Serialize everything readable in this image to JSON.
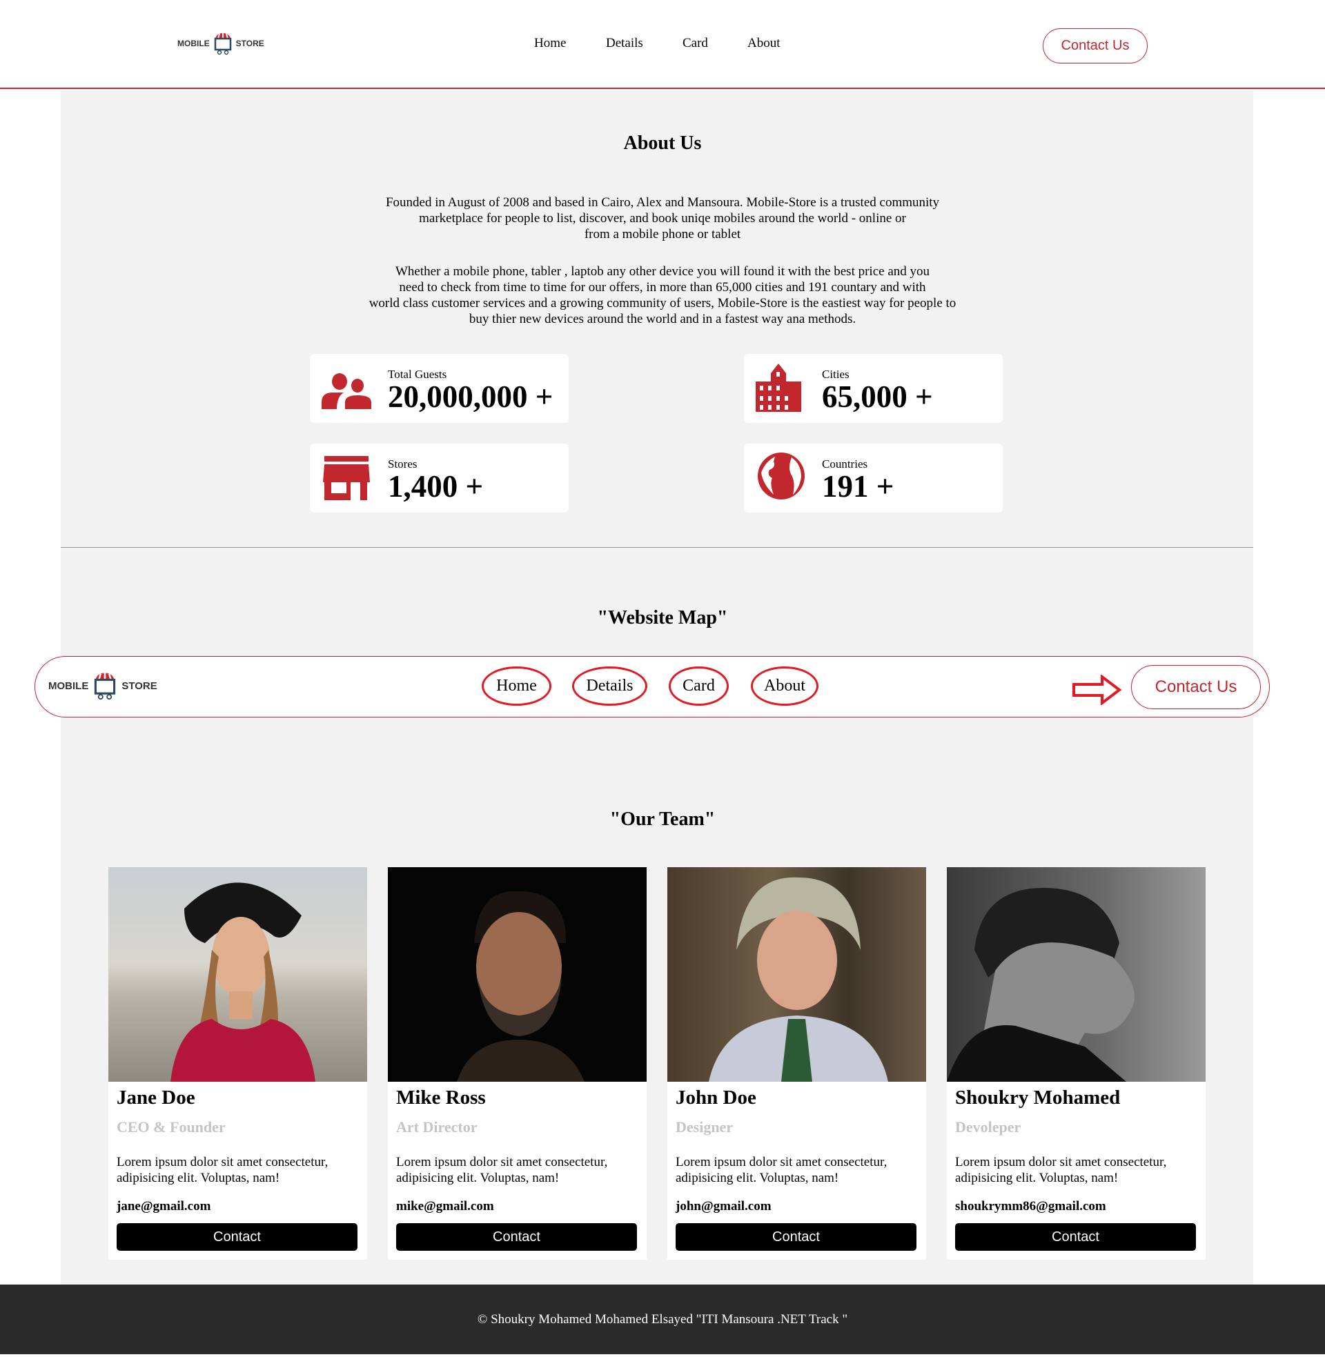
{
  "header": {
    "logo_left": "MOBILE",
    "logo_right": "STORE",
    "nav": [
      "Home",
      "Details",
      "Card",
      "About"
    ],
    "contact": "Contact Us"
  },
  "about": {
    "title": "About Us",
    "para1": [
      "Founded in August of 2008 and based in Cairo, Alex and Mansoura. Mobile-Store is a trusted community",
      "marketplace for people to list, discover, and book uniqe mobiles around the world - online or",
      "from a mobile phone or tablet"
    ],
    "para2": [
      "Whether a mobile phone, tabler , laptob any other device you will found it with the best price and you",
      "need to check from time to time for our offers, in more than 65,000 cities and 191 countary and with",
      "world class customer services and a growing community of users, Mobile-Store is the eastiest way for people to",
      "buy thier new devices around the world and in a fastest way ana methods."
    ],
    "stats": [
      {
        "label": "Total Guests",
        "value": "20,000,000 +",
        "icon": "users-icon"
      },
      {
        "label": "Cities",
        "value": "65,000 +",
        "icon": "building-icon"
      },
      {
        "label": "Stores",
        "value": "1,400 +",
        "icon": "store-icon"
      },
      {
        "label": "Countries",
        "value": "191 +",
        "icon": "globe-icon"
      }
    ]
  },
  "map": {
    "title": "\"Website Map\"",
    "logo_left": "MOBILE",
    "logo_right": "STORE",
    "nav": [
      "Home",
      "Details",
      "Card",
      "About"
    ],
    "contact": "Contact Us"
  },
  "team": {
    "title": "\"Our Team\"",
    "members": [
      {
        "name": "Jane Doe",
        "role": "CEO & Founder",
        "desc": "Lorem ipsum dolor sit amet consectetur, adipisicing elit. Voluptas, nam!",
        "email": "jane@gmail.com",
        "button": "Contact"
      },
      {
        "name": "Mike Ross",
        "role": "Art Director",
        "desc": "Lorem ipsum dolor sit amet consectetur, adipisicing elit. Voluptas, nam!",
        "email": "mike@gmail.com",
        "button": "Contact"
      },
      {
        "name": "John Doe",
        "role": "Designer",
        "desc": "Lorem ipsum dolor sit amet consectetur, adipisicing elit. Voluptas, nam!",
        "email": "john@gmail.com",
        "button": "Contact"
      },
      {
        "name": "Shoukry Mohamed",
        "role": "Devoleper",
        "desc": "Lorem ipsum dolor sit amet consectetur, adipisicing elit. Voluptas, nam!",
        "email": "shoukrymm86@gmail.com",
        "button": "Contact"
      }
    ]
  },
  "footer": {
    "text": "© Shoukry Mohamed Mohamed Elsayed \"ITI Mansoura .NET Track \""
  },
  "colors": {
    "accent": "#c1272d",
    "bg": "#f2f2f2",
    "footer": "#2b2b2b"
  }
}
